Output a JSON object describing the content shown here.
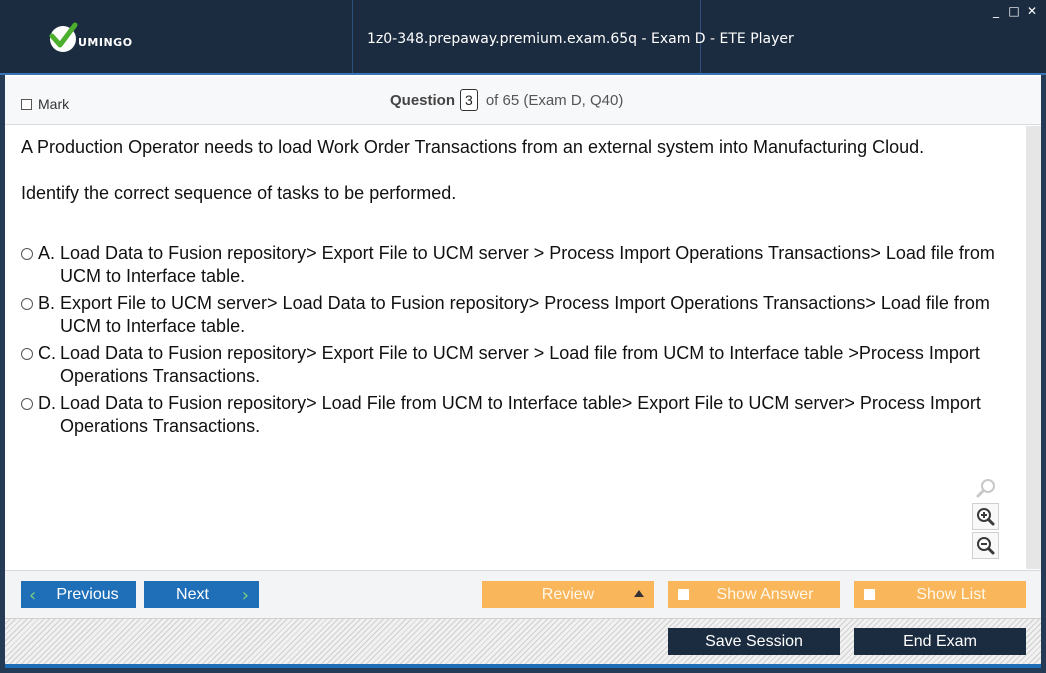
{
  "window": {
    "title": "1z0-348.prepaway.premium.exam.65q - Exam D - ETE Player",
    "logo_text": "UMINGO",
    "controls": [
      "_",
      "□",
      "✕"
    ]
  },
  "header": {
    "mark_label": "Mark",
    "question_label": "Question",
    "question_number": "3",
    "question_of": "of 65 (Exam D, Q40)"
  },
  "question": {
    "paragraphs": [
      "A Production Operator needs to load Work Order Transactions from an external system into Manufacturing Cloud.",
      "Identify the correct sequence of tasks to be performed."
    ],
    "answers": [
      {
        "letter": "A.",
        "text": "Load Data to Fusion repository> Export File to UCM server > Process Import Operations Transactions> Load file from UCM to Interface table."
      },
      {
        "letter": "B.",
        "text": "Export File to UCM server> Load Data to Fusion repository> Process Import Operations Transactions> Load file from UCM to Interface table."
      },
      {
        "letter": "C.",
        "text": "Load Data to Fusion repository> Export File to UCM server > Load file from UCM to Interface table >Process Import Operations Transactions."
      },
      {
        "letter": "D.",
        "text": "Load Data to Fusion repository> Load File from UCM to Interface table> Export File to UCM server> Process Import Operations Transactions."
      }
    ]
  },
  "nav": {
    "previous_label": "Previous",
    "next_label": "Next",
    "review_label": "Review",
    "show_answer_label": "Show Answer",
    "show_list_label": "Show List",
    "save_session_label": "Save Session",
    "end_exam_label": "End Exam"
  },
  "icons": {
    "zoom_reset": "magnifier-icon",
    "zoom_in": "zoom-in-icon",
    "zoom_out": "zoom-out-icon"
  },
  "colors": {
    "titlebar": "#1c2c40",
    "blue_button": "#1f6fb8",
    "orange_button": "#f9b65a",
    "dark_button": "#1c2c40"
  }
}
